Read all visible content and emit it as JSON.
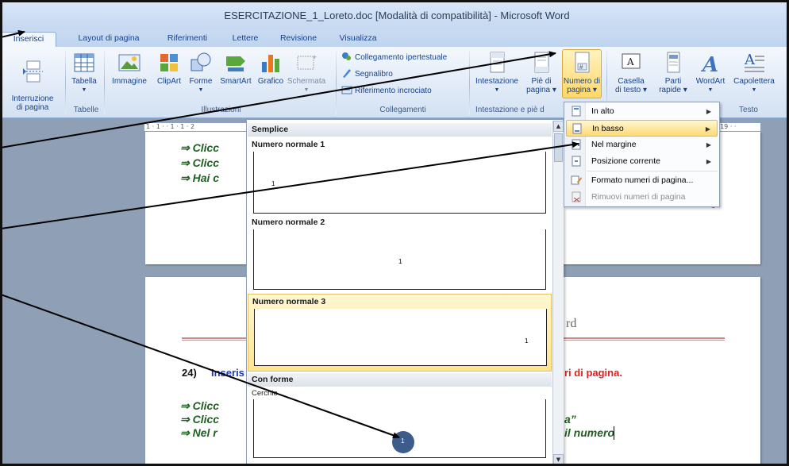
{
  "window": {
    "title": "ESERCITAZIONE_1_Loreto.doc [Modalità di compatibilità] - Microsoft Word"
  },
  "tabs": [
    {
      "label": "Inserisci",
      "active": true
    },
    {
      "label": "Layout di pagina"
    },
    {
      "label": "Riferimenti"
    },
    {
      "label": "Lettere"
    },
    {
      "label": "Revisione"
    },
    {
      "label": "Visualizza"
    }
  ],
  "ribbon": {
    "interruzione": "Interruzione\ndi pagina",
    "tabella": "Tabella",
    "immagine": "Immagine",
    "clipart": "ClipArt",
    "forme": "Forme",
    "smartart": "SmartArt",
    "grafico": "Grafico",
    "schermata": "Schermata",
    "collegamento_ipertestuale": "Collegamento ipertestuale",
    "segnalibro": "Segnalibro",
    "riferimento_incrociato": "Riferimento incrociato",
    "intestazione": "Intestazione",
    "pie_di_pagina_1": "Piè di",
    "pie_di_pagina_2": "pagina",
    "numero_di_pagina_1": "Numero di",
    "numero_di_pagina_2": "pagina",
    "casella_1": "Casella",
    "casella_2": "di testo",
    "parti_1": "Parti",
    "parti_2": "rapide",
    "wordart": "WordArt",
    "capolettera": "Capolettera",
    "groups": {
      "tabelle": "Tabelle",
      "illustrazioni": "Illustrazioni",
      "collegamenti": "Collegamenti",
      "intestazione_pie": "Intestazione e piè d",
      "testo": "Testo"
    }
  },
  "gallery": {
    "section_semplice": "Semplice",
    "section_con_forme": "Con forme",
    "items": [
      {
        "label": "Numero normale 1",
        "sample": "1"
      },
      {
        "label": "Numero normale 2",
        "sample": "1"
      },
      {
        "label": "Numero normale 3",
        "sample": "1",
        "selected": true
      },
      {
        "label": "Cerchio",
        "sample": "1"
      }
    ]
  },
  "menu": {
    "items": [
      {
        "label": "In alto",
        "submenu": true
      },
      {
        "label": "In basso",
        "submenu": true,
        "highlighted": true
      },
      {
        "label": "Nel margine",
        "submenu": true
      },
      {
        "label": "Posizione corrente",
        "submenu": true
      },
      {
        "label": "Formato numeri di pagina..."
      },
      {
        "label": "Rimuovi numeri di pagina",
        "disabled": true
      }
    ]
  },
  "ruler": {
    "left_marks": "1 · 1 ·    · 1 · 1 · 2",
    "right_marks": "· 19 · ·"
  },
  "document": {
    "page1_lines": [
      "⇒ Clicc",
      "⇒ Clicc",
      "⇒ Hai c"
    ],
    "page1_right": "0",
    "header_fragment": "rd",
    "step_number": "24)",
    "step_text_left": "Inseris",
    "step_text_right": "ri di pagina.",
    "page2_lines": [
      "⇒ Clicc",
      "⇒ Clicc",
      "⇒ Nel r"
    ],
    "page2_right_1": "a”",
    "page2_right_2": "il numero"
  },
  "colors": {
    "ribbon_accent": "#15428b",
    "highlight": "#ffd766",
    "doc_green": "#1f5f1f",
    "step_blue": "#1f35c8",
    "step_red": "#e02020",
    "circle_blue": "#3d5c8c"
  }
}
